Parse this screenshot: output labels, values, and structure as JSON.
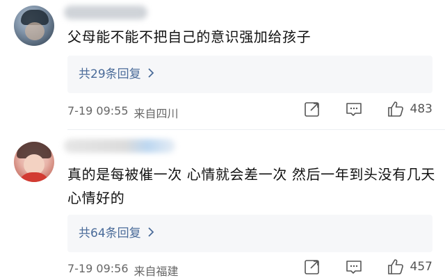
{
  "comments": [
    {
      "text": "父母能不能不把自己的意识强加给孩子",
      "reply_link": "共29条回复",
      "date": "7-19 09:55",
      "location": "来自四川",
      "likes": "483"
    },
    {
      "text": "真的是每被催一次 心情就会差一次 然后一年到头没有几天心情好的",
      "reply_link": "共64条回复",
      "date": "7-19 09:56",
      "location": "来自福建",
      "likes": "457"
    }
  ],
  "icons": {
    "share": "share-icon",
    "comment": "comment-icon",
    "like": "thumbs-up-icon",
    "chevron": "chevron-right-icon"
  },
  "colors": {
    "reply_link": "#4a6b99",
    "reply_box_bg": "#f6f7f9",
    "meta_text": "#666666"
  }
}
